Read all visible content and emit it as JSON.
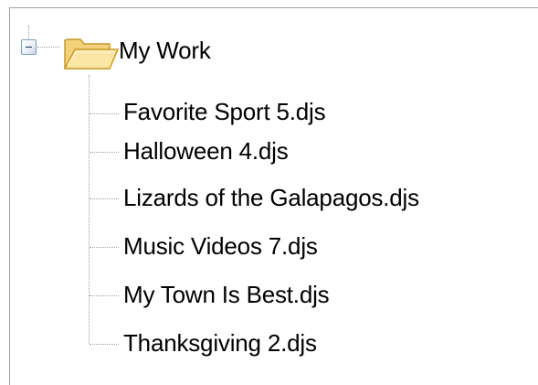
{
  "tree": {
    "root": {
      "label": "My Work",
      "expanded": true,
      "icon": "open-folder-icon"
    },
    "items": [
      {
        "label": "Favorite Sport 5.djs"
      },
      {
        "label": "Halloween 4.djs"
      },
      {
        "label": "Lizards of the Galapagos.djs"
      },
      {
        "label": "Music Videos 7.djs"
      },
      {
        "label": "My Town Is Best.djs"
      },
      {
        "label": "Thanksgiving 2.djs"
      }
    ]
  },
  "colors": {
    "tree_line": "#a0a0a0",
    "folder_fill": "#f6d98c",
    "folder_outline": "#c89a2e",
    "toggle_border": "#7f9db9"
  }
}
